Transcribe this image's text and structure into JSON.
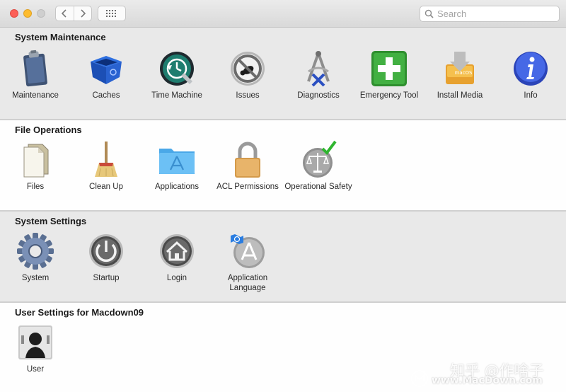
{
  "toolbar": {
    "search_placeholder": "Search"
  },
  "sections": {
    "maintenance": {
      "title": "System Maintenance",
      "items": [
        {
          "label": "Maintenance",
          "icon": "clipboard-icon"
        },
        {
          "label": "Caches",
          "icon": "recycle-bin-icon"
        },
        {
          "label": "Time Machine",
          "icon": "time-machine-icon"
        },
        {
          "label": "Issues",
          "icon": "no-bug-icon"
        },
        {
          "label": "Diagnostics",
          "icon": "caliper-icon"
        },
        {
          "label": "Emergency Tool",
          "icon": "first-aid-icon"
        },
        {
          "label": "Install Media",
          "icon": "install-drive-icon"
        },
        {
          "label": "Info",
          "icon": "info-icon"
        }
      ],
      "install_media_badge": "macOS"
    },
    "file_operations": {
      "title": "File Operations",
      "items": [
        {
          "label": "Files",
          "icon": "documents-icon"
        },
        {
          "label": "Clean Up",
          "icon": "broom-icon"
        },
        {
          "label": "Applications",
          "icon": "applications-folder-icon"
        },
        {
          "label": "ACL Permissions",
          "icon": "padlock-icon"
        },
        {
          "label": "Operational Safety",
          "icon": "scales-check-icon"
        }
      ]
    },
    "system_settings": {
      "title": "System Settings",
      "items": [
        {
          "label": "System",
          "icon": "gear-icon"
        },
        {
          "label": "Startup",
          "icon": "power-icon"
        },
        {
          "label": "Login",
          "icon": "home-icon"
        },
        {
          "label": "Application Language",
          "icon": "app-store-globe-icon"
        }
      ]
    },
    "user_settings": {
      "title": "User Settings for Macdown09",
      "items": [
        {
          "label": "User",
          "icon": "user-silhouette-icon"
        }
      ]
    }
  },
  "watermark": {
    "brand": "知乎 @作啥子",
    "url": "www.MacDown.com"
  },
  "colors": {
    "close": "#fc5f57",
    "minimize": "#fdbc2e",
    "emergency_green": "#3aa33a",
    "info_blue": "#3b5fd6"
  }
}
